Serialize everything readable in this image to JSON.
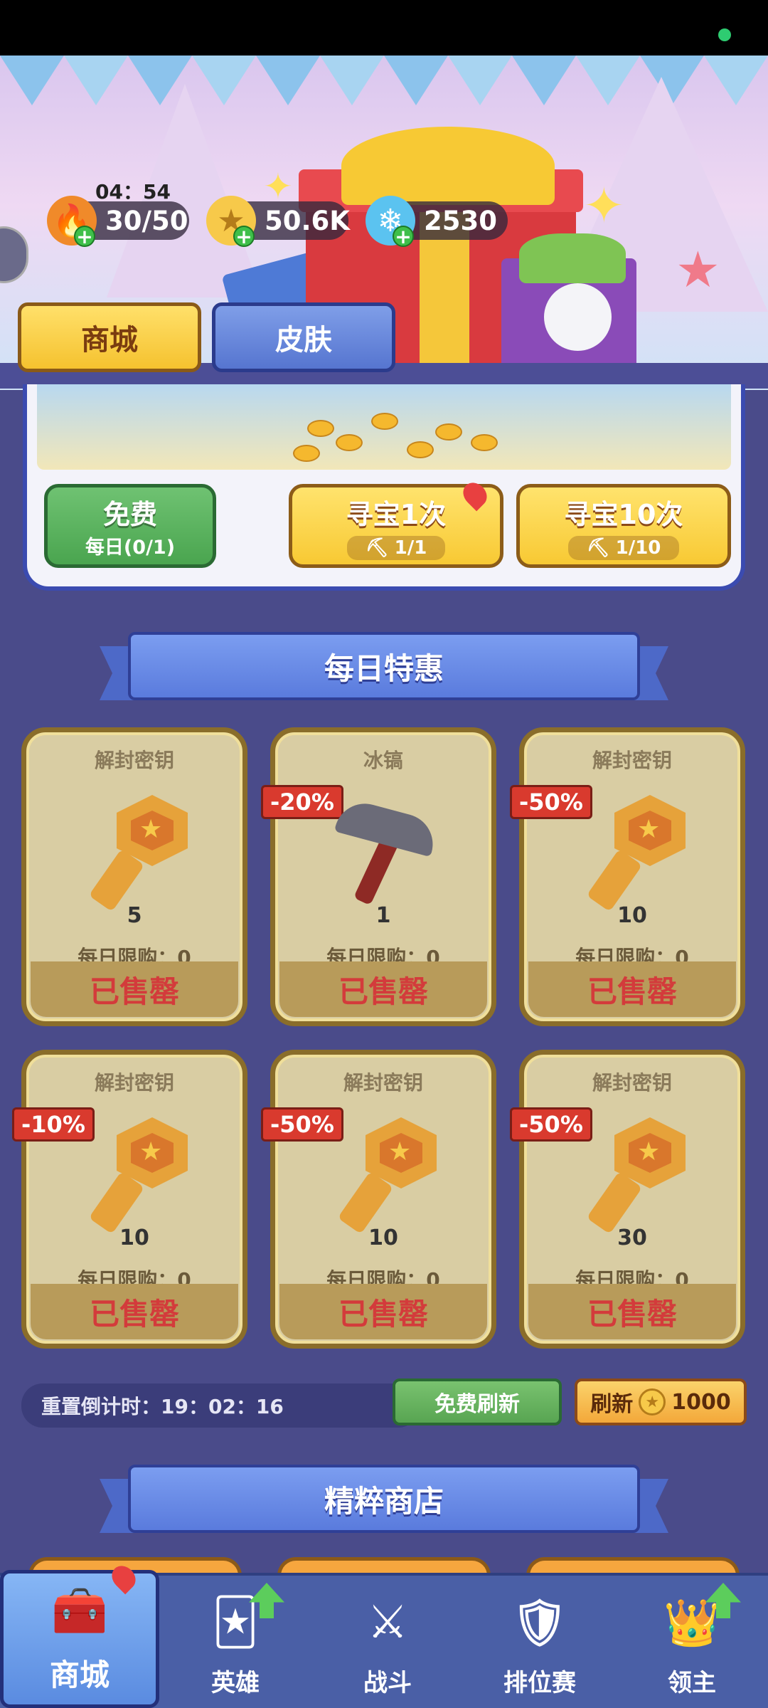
{
  "status": {
    "indicator_color": "#2ecc71"
  },
  "header": {
    "timer": "04：54",
    "resources": {
      "energy": {
        "value": "30/50",
        "icon": "flame-icon"
      },
      "gold": {
        "value": "50.6K",
        "icon": "gold-coin-icon"
      },
      "gems": {
        "value": "2530",
        "icon": "crystal-icon"
      }
    }
  },
  "tabs": {
    "shop": "商城",
    "skin": "皮肤"
  },
  "treasure": {
    "free": {
      "label": "免费",
      "sub": "每日(0/1)"
    },
    "once": {
      "label": "寻宝1次",
      "count": "1/1"
    },
    "ten": {
      "label": "寻宝10次",
      "count": "1/10"
    }
  },
  "daily": {
    "title": "每日特惠",
    "items": [
      {
        "name": "解封密钥",
        "qty": "5",
        "limit": "每日限购：0",
        "status": "已售罄",
        "discount": "",
        "icon": "key-icon"
      },
      {
        "name": "冰镐",
        "qty": "1",
        "limit": "每日限购：0",
        "status": "已售罄",
        "discount": "-20%",
        "icon": "pickaxe-icon"
      },
      {
        "name": "解封密钥",
        "qty": "10",
        "limit": "每日限购：0",
        "status": "已售罄",
        "discount": "-50%",
        "icon": "key-icon"
      },
      {
        "name": "解封密钥",
        "qty": "10",
        "limit": "每日限购：0",
        "status": "已售罄",
        "discount": "-10%",
        "icon": "key-icon"
      },
      {
        "name": "解封密钥",
        "qty": "10",
        "limit": "每日限购：0",
        "status": "已售罄",
        "discount": "-50%",
        "icon": "key-icon"
      },
      {
        "name": "解封密钥",
        "qty": "30",
        "limit": "每日限购：0",
        "status": "已售罄",
        "discount": "-50%",
        "icon": "key-icon"
      }
    ],
    "reset": "重置倒计时：19：02：16",
    "free_refresh": "免费刷新",
    "refresh": {
      "label": "刷新",
      "cost": "1000"
    }
  },
  "essence": {
    "title": "精粹商店"
  },
  "nav": {
    "shop": "商城",
    "heroes": "英雄",
    "battle": "战斗",
    "ranked": "排位赛",
    "lord": "领主"
  }
}
